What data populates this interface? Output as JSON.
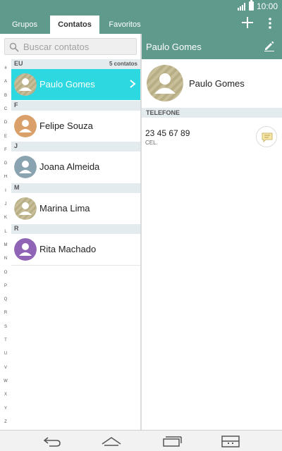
{
  "status": {
    "time": "10:00"
  },
  "tabs": [
    {
      "label": "Grupos"
    },
    {
      "label": "Contatos"
    },
    {
      "label": "Favoritos"
    }
  ],
  "search": {
    "placeholder": "Buscar contatos"
  },
  "index_letters": [
    "#",
    "A",
    "B",
    "C",
    "D",
    "E",
    "F",
    "G",
    "H",
    "I",
    "J",
    "K",
    "L",
    "M",
    "N",
    "O",
    "P",
    "Q",
    "R",
    "S",
    "T",
    "U",
    "V",
    "W",
    "X",
    "Y",
    "Z"
  ],
  "sections": [
    {
      "letter": "EU",
      "count": "5 contatos"
    },
    {
      "letter": "F"
    },
    {
      "letter": "J"
    },
    {
      "letter": "M"
    },
    {
      "letter": "R"
    }
  ],
  "contacts": [
    {
      "name": "Paulo Gomes",
      "avatar": "striped-avatar"
    },
    {
      "name": "Felipe Souza",
      "avatar": "orange-avatar"
    },
    {
      "name": "Joana Almeida",
      "avatar": "grey-blue-avatar"
    },
    {
      "name": "Marina Lima",
      "avatar": "striped-avatar"
    },
    {
      "name": "Rita Machado",
      "avatar": "purple-avatar"
    }
  ],
  "detail": {
    "header_title": "Paulo Gomes",
    "name": "Paulo Gomes",
    "phone_section": "TELEFONE",
    "phone_number": "23 45 67 89",
    "phone_type": "CEL."
  },
  "colors": {
    "appbar": "#5f9a8d",
    "selected_row": "#2dd8e0",
    "section_bg": "#e4ebee"
  }
}
